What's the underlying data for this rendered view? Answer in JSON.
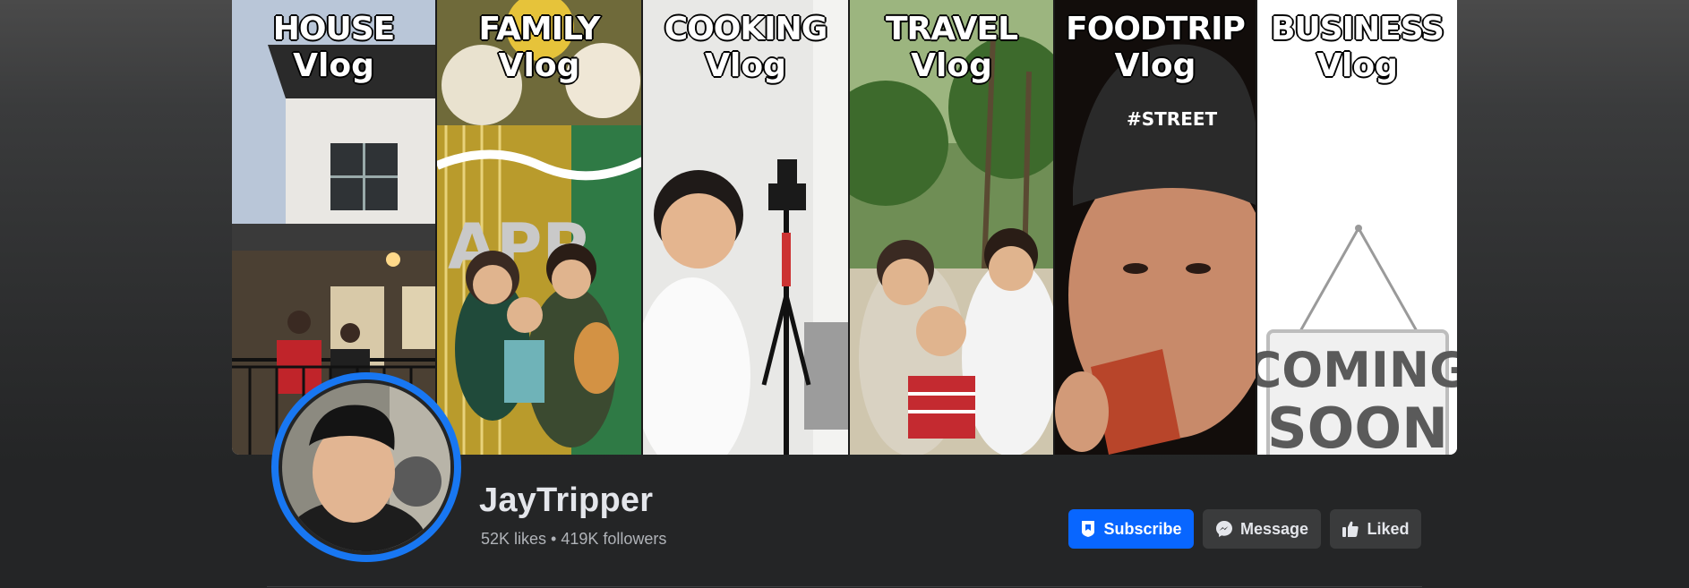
{
  "cover": {
    "panels": [
      {
        "line1": "HOUSE",
        "line2": "Vlog"
      },
      {
        "line1": "FAMILY",
        "line2": "Vlog"
      },
      {
        "line1": "COOKING",
        "line2": "Vlog"
      },
      {
        "line1": "TRAVEL",
        "line2": "Vlog"
      },
      {
        "line1": "FOODTRIP",
        "line2": "Vlog"
      },
      {
        "line1": "BUSINESS",
        "line2": "Vlog",
        "sign_line1": "COMING",
        "sign_line2": "SOON"
      }
    ],
    "cap_text": "#STREET"
  },
  "profile": {
    "name": "JayTripper",
    "stats": "52K likes • 419K followers"
  },
  "actions": {
    "subscribe_label": "Subscribe",
    "message_label": "Message",
    "liked_label": "Liked"
  },
  "colors": {
    "accent": "#0866ff",
    "avatar_ring": "#1877f2",
    "button_bg": "#3a3b3c",
    "text_primary": "#e4e6eb",
    "text_secondary": "#b0b3b8"
  },
  "icons": {
    "subscribe": "shield-bookmark-icon",
    "message": "messenger-icon",
    "liked": "thumbs-up-icon"
  }
}
